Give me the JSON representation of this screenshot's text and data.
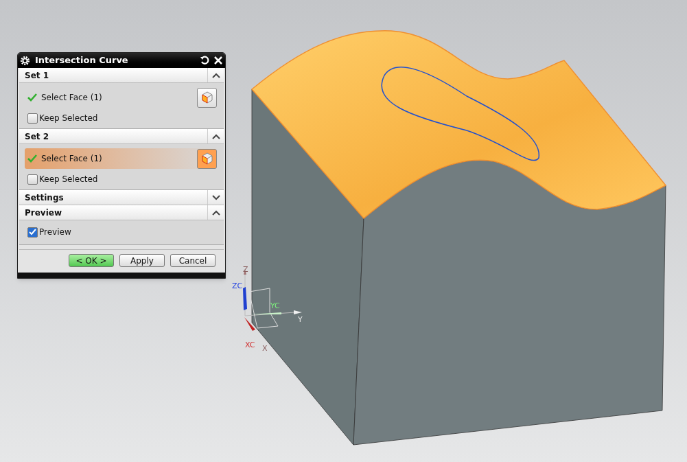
{
  "dialog": {
    "title": "Intersection Curve",
    "sections": [
      {
        "kind": "selection",
        "title": "Set 1",
        "expanded": true,
        "selection": {
          "label": "Select Face (1)",
          "complete": true,
          "active": false
        },
        "checkbox": {
          "label": "Keep Selected",
          "checked": false
        }
      },
      {
        "kind": "selection",
        "title": "Set 2",
        "expanded": true,
        "selection": {
          "label": "Select Face (1)",
          "complete": true,
          "active": true
        },
        "checkbox": {
          "label": "Keep Selected",
          "checked": false
        }
      },
      {
        "title": "Settings",
        "expanded": false
      },
      {
        "kind": "check",
        "title": "Preview",
        "expanded": true,
        "checkbox": {
          "label": "Preview",
          "checked": true
        }
      }
    ],
    "buttons": [
      {
        "label": "< OK >",
        "kind": "default"
      },
      {
        "label": "Apply",
        "kind": "normal"
      },
      {
        "label": "Cancel",
        "kind": "normal"
      }
    ]
  },
  "triad": {
    "labels": [
      {
        "text": "Z",
        "kind": "z"
      },
      {
        "text": "ZC",
        "kind": "zc"
      },
      {
        "text": "YC",
        "kind": "yc"
      },
      {
        "text": "Y",
        "kind": "y"
      },
      {
        "text": "XC",
        "kind": "xc"
      },
      {
        "text": "X",
        "kind": "x"
      }
    ]
  }
}
